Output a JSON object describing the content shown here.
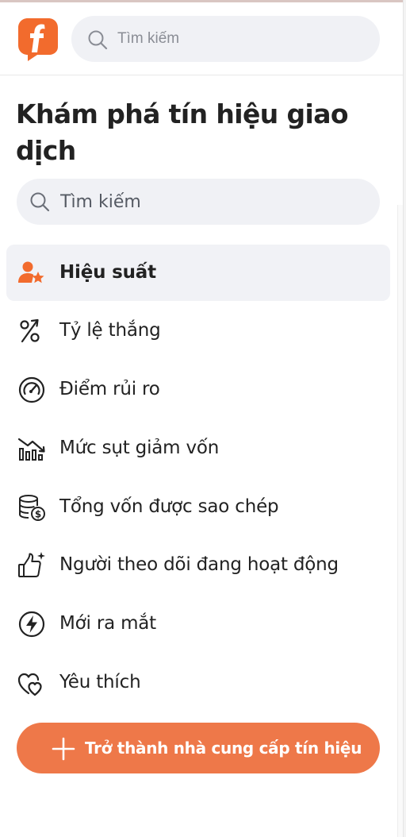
{
  "header": {
    "brand_color": "#F26B2D",
    "logo_icon": "f-logo-icon",
    "search": {
      "placeholder": "Tìm kiếm",
      "value": ""
    }
  },
  "sidebar": {
    "title": "Khám phá tín hiệu giao dịch",
    "search": {
      "placeholder": "Tìm kiếm",
      "value": ""
    },
    "items": [
      {
        "label": "Hiệu suất",
        "icon": "user-star-icon",
        "active": true
      },
      {
        "label": "Tỷ lệ thắng",
        "icon": "percent-up-icon",
        "active": false
      },
      {
        "label": "Điểm rủi ro",
        "icon": "gauge-icon",
        "active": false
      },
      {
        "label": "Mức sụt giảm vốn",
        "icon": "drawdown-chart-icon",
        "active": false
      },
      {
        "label": "Tổng vốn được sao chép",
        "icon": "coins-stack-icon",
        "active": false
      },
      {
        "label": "Người theo dõi đang hoạt động",
        "icon": "thumbs-up-sparkle-icon",
        "active": false
      },
      {
        "label": "Mới ra mắt",
        "icon": "lightning-circle-icon",
        "active": false
      },
      {
        "label": "Yêu thích",
        "icon": "hearts-icon",
        "active": false
      }
    ],
    "cta": {
      "label": "Trở thành nhà cung cấp tín hiệu",
      "icon": "plus-icon",
      "color": "#EE7849"
    }
  },
  "colors": {
    "active_bg": "#F1F2F6",
    "search_bg": "#F0F1F5",
    "accent": "#F26B2D"
  }
}
